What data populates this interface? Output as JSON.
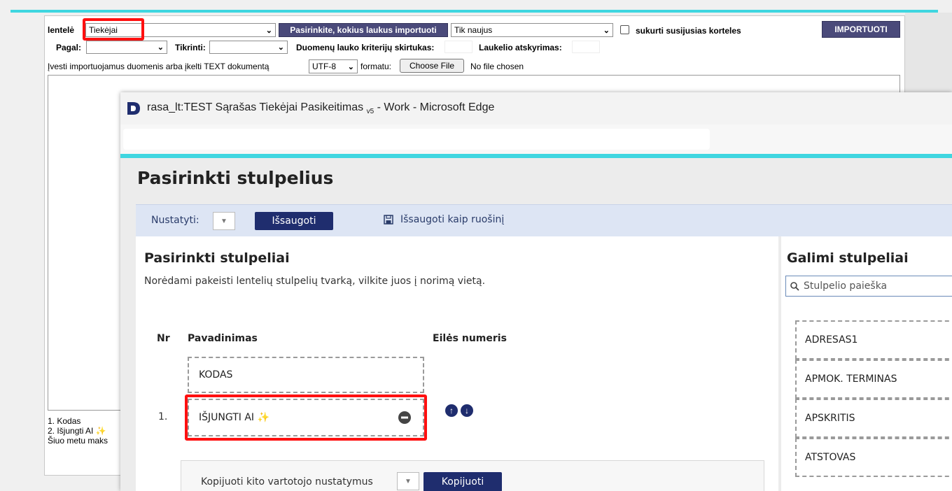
{
  "import_form": {
    "table_label": "lentelė",
    "table_value": "Tiekėjai",
    "fields_button": "Pasirinkite,  kokius laukus importuoti",
    "mode_value": "Tik naujus",
    "create_related_label": "sukurti susijusias korteles",
    "import_button": "IMPORTUOTI",
    "by_label": "Pagal:",
    "check_label": "Tikrinti:",
    "criteria_sep_label": "Duomenų lauko kriterijų skirtukas:",
    "field_sep_label": "Laukelio atskyrimas:",
    "enter_label": "Įvesti importuojamus duomenis arba įkelti TEXT dokumentą",
    "encoding_value": "UTF-8",
    "format_label": "formatu:",
    "choose_file": "Choose File",
    "no_file": "No file chosen",
    "preview_lines": [
      "1. Kodas",
      "2. Išjungti AI",
      "Šiuo metu maks"
    ]
  },
  "edge": {
    "window_title": "rasa_lt:TEST Sąrašas Tiekėjai Pasikeitimas",
    "version_sub": "v5",
    "window_title_suffix": " - Work - Microsoft Edge",
    "page_title": "Pasirinkti stulpelius",
    "toolbar": {
      "preset_label": "Nustatyti:",
      "save_button": "Išsaugoti",
      "save_as": "Išsaugoti kaip ruošinį"
    },
    "selected": {
      "heading": "Pasirinkti stulpeliai",
      "description": "Norėdami pakeisti lentelių stulpelių tvarką, vilkite juos į norimą vietą.",
      "col_nr": "Nr",
      "col_name": "Pavadinimas",
      "col_order": "Eilės numeris",
      "fixed_item": "KODAS",
      "rows": [
        {
          "nr": "1.",
          "name": "IŠJUNGTI AI"
        }
      ],
      "copy_label": "Kopijuoti kito vartotojo nustatymus",
      "copy_button": "Kopijuoti"
    },
    "available": {
      "heading": "Galimi stulpeliai",
      "search_placeholder": "Stulpelio paieška",
      "items": [
        "ADRESAS1",
        "APMOK. TERMINAS",
        "APSKRITIS",
        "ATSTOVAS"
      ]
    }
  },
  "colors": {
    "accent_cyan": "#3fd6e0",
    "navy": "#1f2d6e",
    "highlight_red": "#ff1010",
    "sparkle": "#f5a623"
  }
}
